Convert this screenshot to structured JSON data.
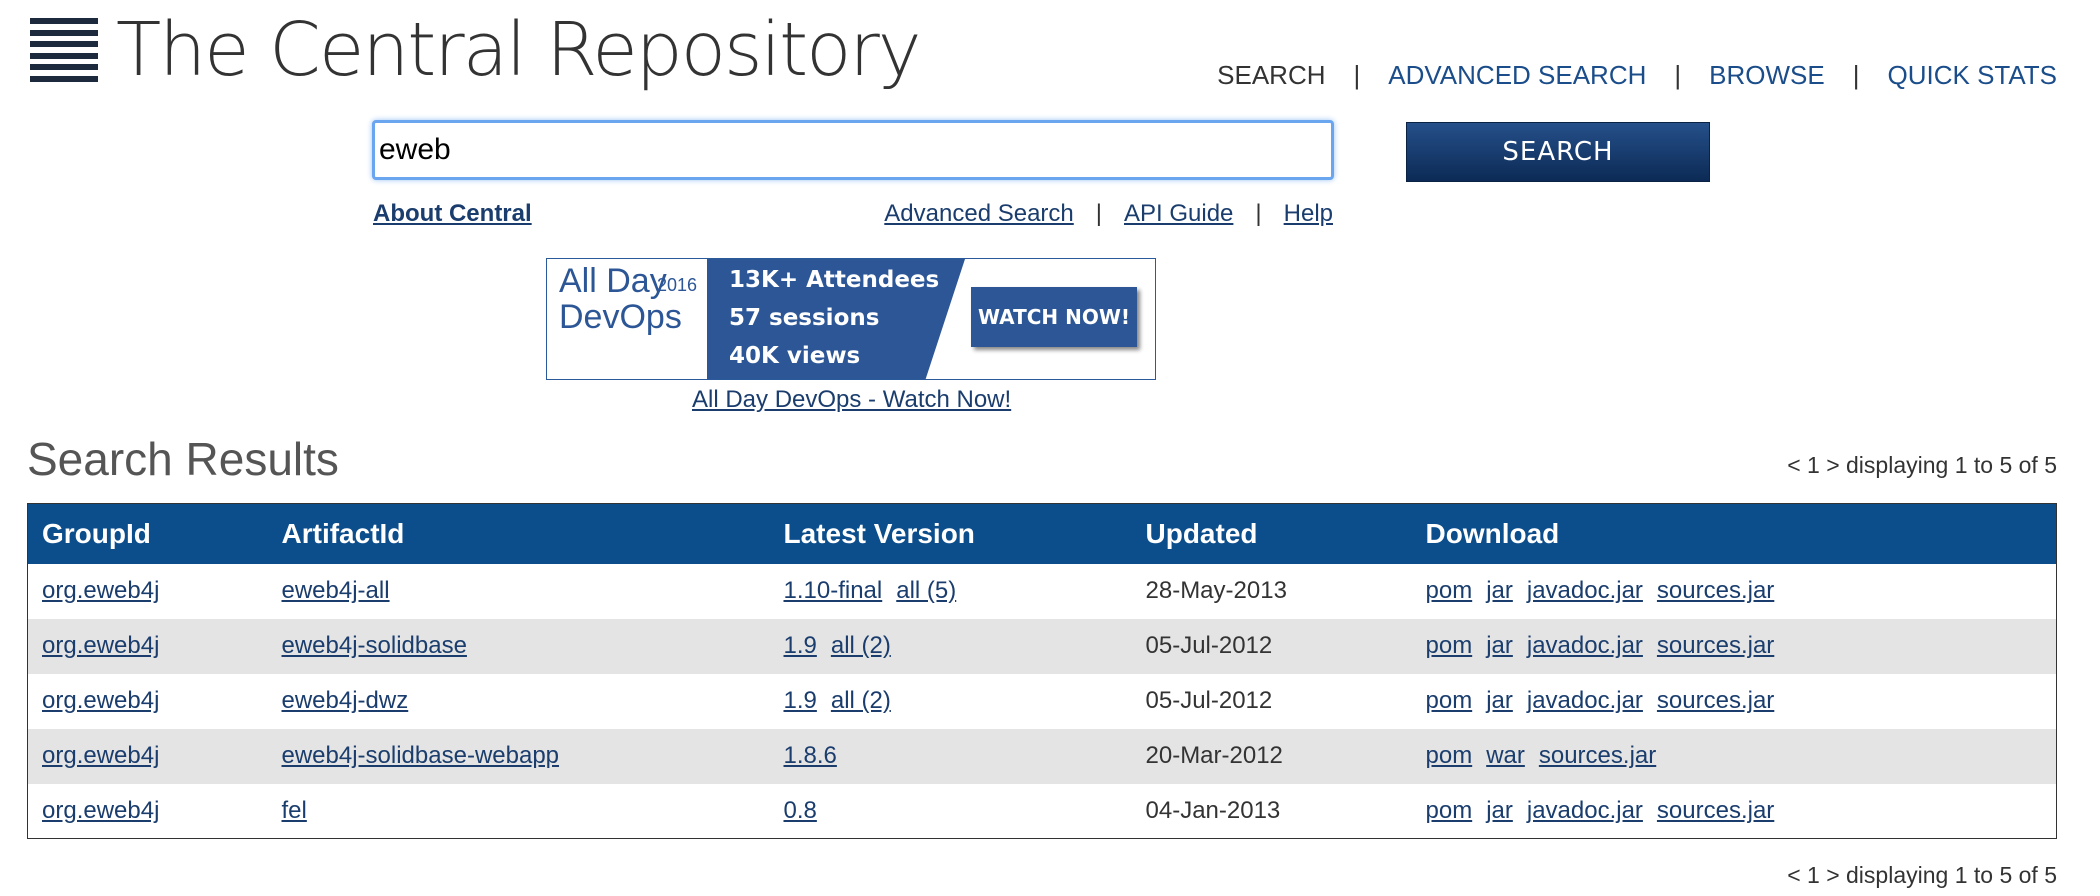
{
  "header": {
    "logo_text": "The Central Repository",
    "nav": [
      {
        "label": "SEARCH",
        "current": true
      },
      {
        "label": "ADVANCED SEARCH",
        "current": false
      },
      {
        "label": "BROWSE",
        "current": false
      },
      {
        "label": "QUICK STATS",
        "current": false
      }
    ]
  },
  "search": {
    "value": "eweb",
    "button_label": "SEARCH"
  },
  "links": {
    "about": "About Central",
    "advanced_search": "Advanced Search",
    "api_guide": "API Guide",
    "help": "Help"
  },
  "banner": {
    "logo_text": "All Day DevOps",
    "year": "2016",
    "stats": [
      "13K+ Attendees",
      "57 sessions",
      "40K views"
    ],
    "button_label": "WATCH NOW!",
    "caption": "All Day DevOps - Watch Now!"
  },
  "results": {
    "title": "Search Results",
    "pager": "< 1 > displaying 1 to 5 of 5",
    "columns": [
      "GroupId",
      "ArtifactId",
      "Latest Version",
      "Updated",
      "Download"
    ],
    "rows": [
      {
        "group": "org.eweb4j",
        "artifact": "eweb4j-all",
        "version": "1.10-final",
        "all": "all (5)",
        "updated": "28-May-2013",
        "downloads": [
          "pom",
          "jar",
          "javadoc.jar",
          "sources.jar"
        ]
      },
      {
        "group": "org.eweb4j",
        "artifact": "eweb4j-solidbase",
        "version": "1.9",
        "all": "all (2)",
        "updated": "05-Jul-2012",
        "downloads": [
          "pom",
          "jar",
          "javadoc.jar",
          "sources.jar"
        ]
      },
      {
        "group": "org.eweb4j",
        "artifact": "eweb4j-dwz",
        "version": "1.9",
        "all": "all (2)",
        "updated": "05-Jul-2012",
        "downloads": [
          "pom",
          "jar",
          "javadoc.jar",
          "sources.jar"
        ]
      },
      {
        "group": "org.eweb4j",
        "artifact": "eweb4j-solidbase-webapp",
        "version": "1.8.6",
        "all": "",
        "updated": "20-Mar-2012",
        "downloads": [
          "pom",
          "war",
          "sources.jar"
        ]
      },
      {
        "group": "org.eweb4j",
        "artifact": "fel",
        "version": "0.8",
        "all": "",
        "updated": "04-Jan-2013",
        "downloads": [
          "pom",
          "jar",
          "javadoc.jar",
          "sources.jar"
        ]
      }
    ]
  }
}
